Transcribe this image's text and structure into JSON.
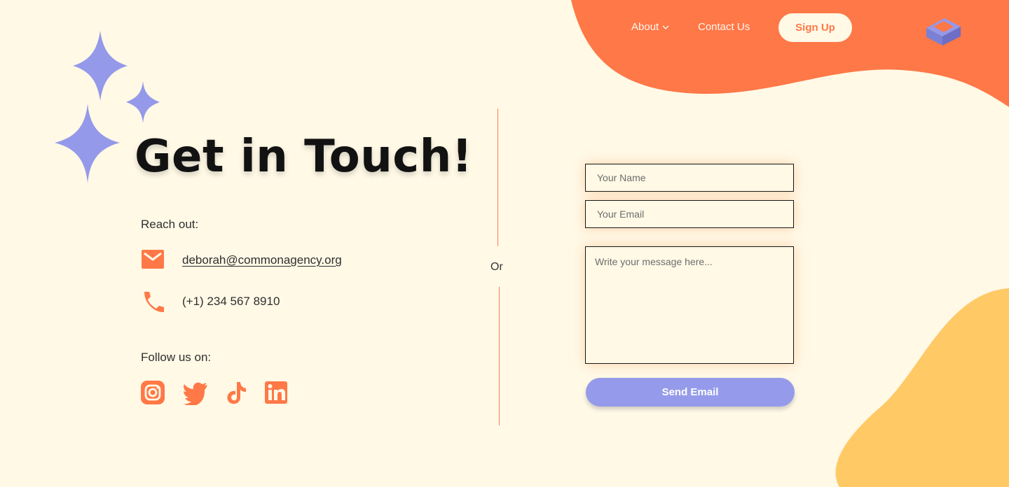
{
  "nav": {
    "about_label": "About",
    "contact_label": "Contact Us",
    "signup_label": "Sign Up"
  },
  "hero": {
    "title": "Get in Touch!"
  },
  "contact": {
    "reach_label": "Reach out:",
    "email": "deborah@commonagency.org",
    "phone": "(+1)  234 567 8910",
    "follow_label": "Follow us on:"
  },
  "divider": {
    "or_label": "Or"
  },
  "form": {
    "name_placeholder": "Your Name",
    "email_placeholder": "Your Email",
    "message_placeholder": "Write your message here...",
    "send_label": "Send Email"
  },
  "icons": {
    "sparkles": "sparkle-icon",
    "logo": "logo-icon",
    "dropdown": "chevron-down-icon",
    "mail": "mail-icon",
    "phone": "phone-icon",
    "instagram": "instagram-icon",
    "twitter": "twitter-icon",
    "tiktok": "tiktok-icon",
    "linkedin": "linkedin-icon"
  },
  "colors": {
    "background": "#fff9e6",
    "accent_orange": "#ff7847",
    "accent_purple": "#959bea",
    "accent_yellow": "#ffc966",
    "title_text": "#121212"
  }
}
